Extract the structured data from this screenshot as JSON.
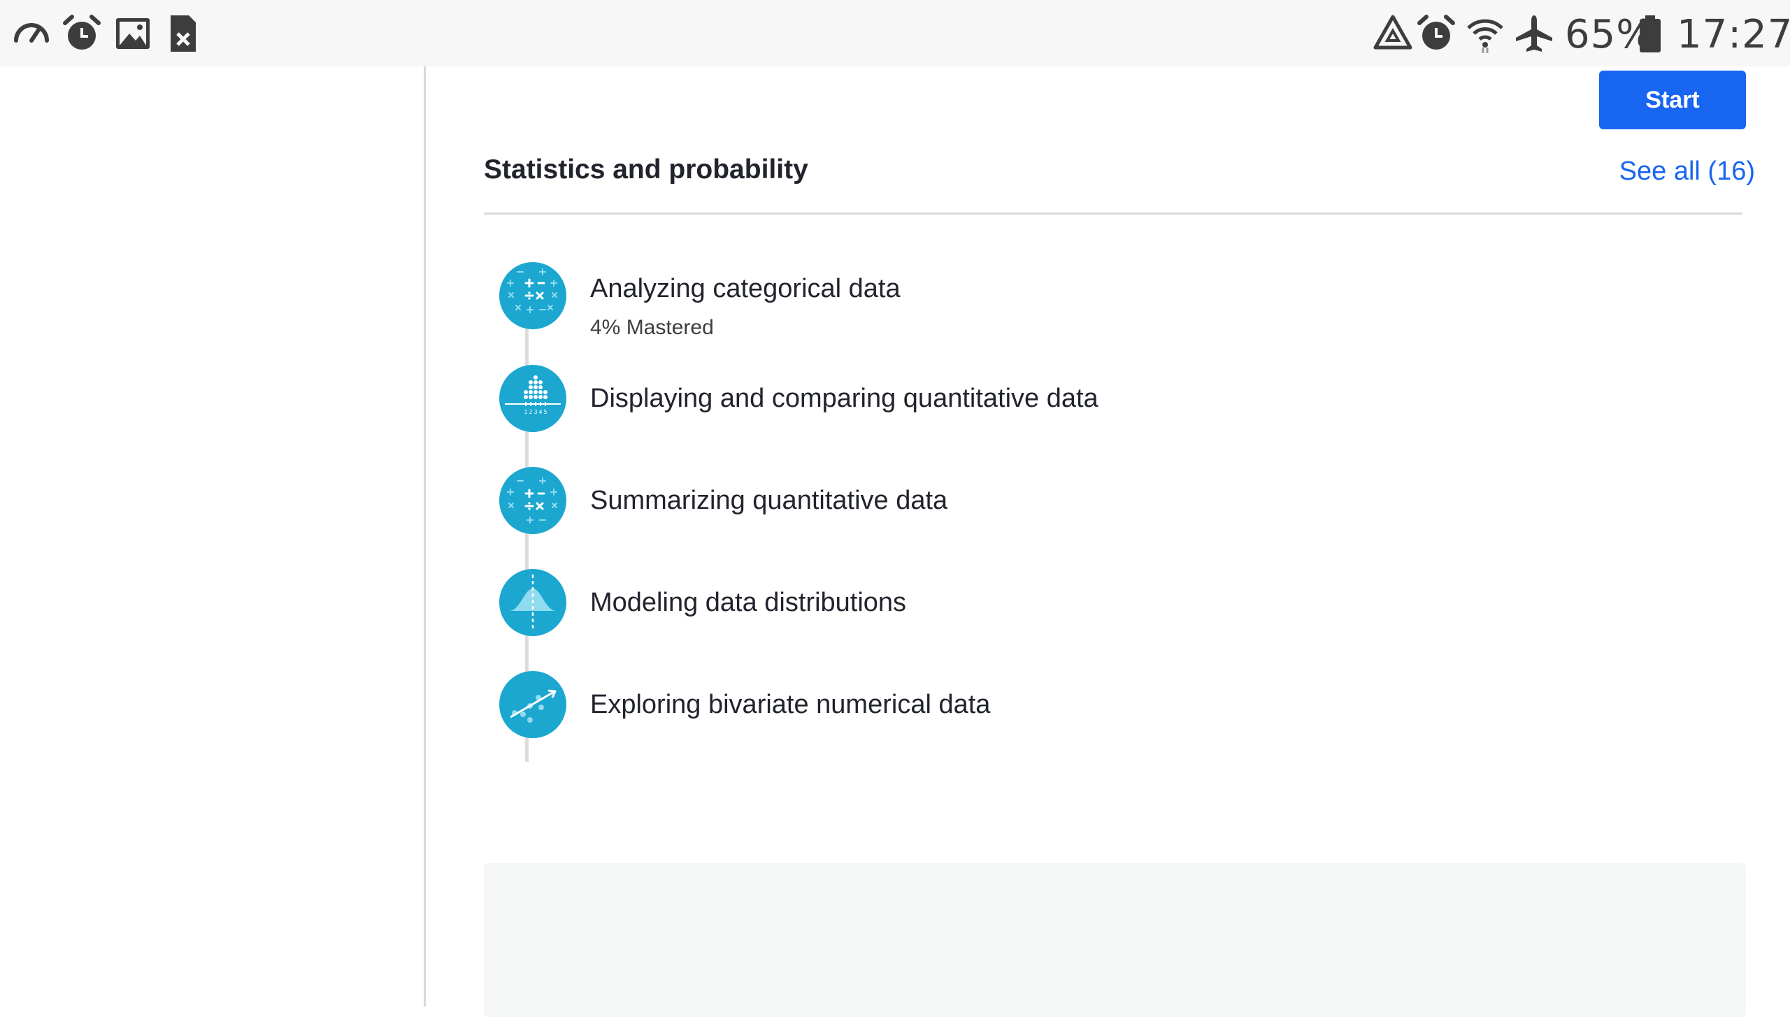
{
  "status_bar": {
    "left_icons": [
      "speedometer-icon",
      "alarm-icon",
      "gallery-icon",
      "blocked-file-icon"
    ],
    "right_icons": [
      "recycle-warning-icon",
      "alarm-icon",
      "wifi-icon",
      "airplane-mode-icon",
      "battery-icon"
    ],
    "battery": "65%",
    "time": "17:27"
  },
  "section": {
    "title": "Statistics and probability",
    "see_all": "See all (16)"
  },
  "units": [
    {
      "title": "Analyzing categorical data",
      "subtitle": "4% Mastered",
      "icon": "math-operators-icon",
      "button": "Start"
    },
    {
      "title": "Displaying and comparing quantitative data",
      "icon": "dot-plot-icon"
    },
    {
      "title": "Summarizing quantitative data",
      "icon": "math-operators-icon"
    },
    {
      "title": "Modeling data distributions",
      "icon": "normal-distribution-icon"
    },
    {
      "title": "Exploring bivariate numerical data",
      "icon": "scatter-trend-icon"
    }
  ],
  "colors": {
    "accent": "#1865f2",
    "unit_icon": "#1ba7cf",
    "status_bar_bg": "#f7f7f7"
  }
}
